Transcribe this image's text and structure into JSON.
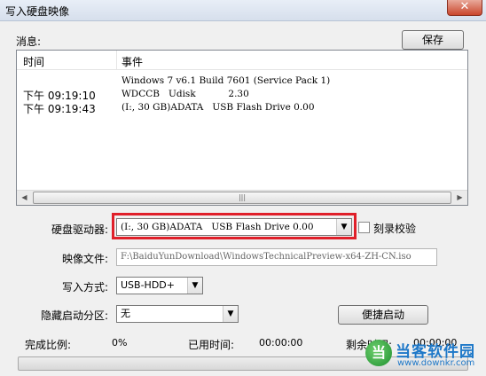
{
  "window": {
    "title": "写入硬盘映像",
    "close_glyph": "✕"
  },
  "messages": {
    "label": "消息:",
    "save_label": "保存",
    "columns": {
      "time": "时间",
      "event": "事件"
    },
    "rows": [
      {
        "time": "",
        "event": "Windows 7 v6.1 Build 7601 (Service Pack 1)"
      },
      {
        "time": "下午 09:19:10",
        "event": "WDCCB   Udisk           2.30"
      },
      {
        "time": "下午 09:19:43",
        "event": "(I:, 30 GB)ADATA   USB Flash Drive 0.00"
      }
    ]
  },
  "drive": {
    "label": "硬盘驱动器:",
    "value": "(I:, 30 GB)ADATA   USB Flash Drive 0.00",
    "verify_label": "刻录校验"
  },
  "image_file": {
    "label": "映像文件:",
    "value": "F:\\BaiduYunDownload\\WindowsTechnicalPreview-x64-ZH-CN.iso"
  },
  "write_mode": {
    "label": "写入方式:",
    "value": "USB-HDD+"
  },
  "hidden_partition": {
    "label": "隐藏启动分区:",
    "value": "无",
    "quick_boot_label": "便捷启动"
  },
  "status": {
    "progress_label": "完成比例:",
    "progress_value": "0%",
    "elapsed_label": "已用时间:",
    "elapsed_value": "00:00:00",
    "remaining_label": "剩余时间:",
    "remaining_value": "00:00:00",
    "progress_fraction": 0
  },
  "watermark": {
    "name": "当客软件园",
    "url": "www.downkr.com",
    "logo_glyph": "当"
  },
  "icons": [
    "close-icon",
    "scroll-left-icon",
    "scroll-right-icon",
    "dropdown-arrow-icon"
  ],
  "colors": {
    "highlight": "#e0202a",
    "titlebar": "#dce4f0",
    "close_button": "#c9462c",
    "watermark": "#1e78c8"
  }
}
